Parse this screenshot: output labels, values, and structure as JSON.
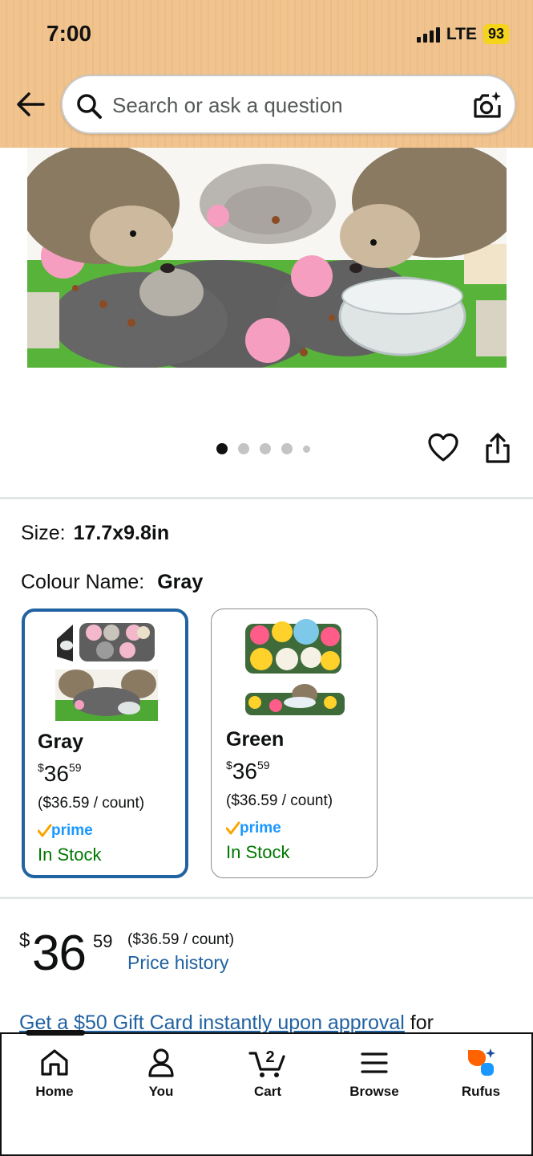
{
  "status_bar": {
    "time": "7:00",
    "network": "LTE",
    "battery": "93"
  },
  "search": {
    "placeholder": "Search or ask a question"
  },
  "carousel": {
    "total_images": 5,
    "current_index": 1
  },
  "product": {
    "size_label": "Size:",
    "size_value": "17.7x9.8in",
    "colour_label": "Colour Name:",
    "colour_value": "Gray"
  },
  "colour_options": [
    {
      "name": "Gray",
      "currency": "$",
      "price_whole": "36",
      "price_fraction": "59",
      "unit_price": "($36.59 / count)",
      "prime": "prime",
      "availability": "In Stock",
      "selected": true
    },
    {
      "name": "Green",
      "currency": "$",
      "price_whole": "36",
      "price_fraction": "59",
      "unit_price": "($36.59 / count)",
      "prime": "prime",
      "availability": "In Stock",
      "selected": false
    }
  ],
  "price": {
    "currency": "$",
    "whole": "36",
    "fraction": "59",
    "unit_price": "($36.59 / count)",
    "history_link": "Price history"
  },
  "promo": {
    "link_text": "Get a $50 Gift Card instantly upon approval",
    "rest_text": " for"
  },
  "bottom_nav": {
    "items": [
      {
        "label": "Home",
        "icon": "home-icon"
      },
      {
        "label": "You",
        "icon": "person-icon"
      },
      {
        "label": "Cart",
        "icon": "cart-icon",
        "count": "2"
      },
      {
        "label": "Browse",
        "icon": "menu-icon"
      },
      {
        "label": "Rufus",
        "icon": "rufus-icon"
      }
    ]
  },
  "colors": {
    "link_blue": "#2162a1",
    "stock_green": "#007600",
    "prime_blue": "#1a98ff",
    "prime_check": "#f7a600",
    "header_orange": "#f1c48f",
    "rufus_orange": "#ff6200"
  }
}
